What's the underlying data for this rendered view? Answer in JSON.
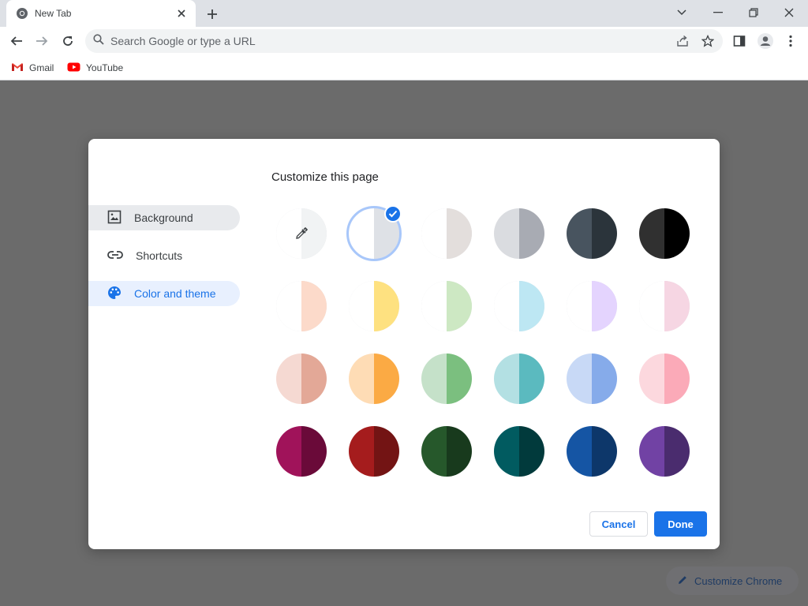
{
  "tab": {
    "title": "New Tab"
  },
  "omnibox": {
    "placeholder": "Search Google or type a URL"
  },
  "bookmarks": [
    {
      "label": "Gmail",
      "icon": "gmail-icon"
    },
    {
      "label": "YouTube",
      "icon": "youtube-icon"
    }
  ],
  "dialog": {
    "title": "Customize this page",
    "menu": [
      {
        "label": "Background",
        "icon": "image-icon",
        "state": "hover"
      },
      {
        "label": "Shortcuts",
        "icon": "link-icon",
        "state": "normal"
      },
      {
        "label": "Color and theme",
        "icon": "palette-icon",
        "state": "selected"
      }
    ],
    "swatches": [
      {
        "name": "custom-color-picker",
        "left": "#ffffff",
        "right": "#f1f3f4",
        "selected": false
      },
      {
        "name": "default",
        "left": "#ffffff",
        "right": "#dee1e6",
        "selected": true
      },
      {
        "name": "warm-grey",
        "left": "#ffffff",
        "right": "#e3dedc",
        "selected": false
      },
      {
        "name": "cool-grey",
        "left": "#dadce0",
        "right": "#a8abb3",
        "selected": false
      },
      {
        "name": "midnight-blue",
        "left": "#48545f",
        "right": "#2b343b",
        "selected": false
      },
      {
        "name": "black",
        "left": "#303030",
        "right": "#000000",
        "selected": false
      },
      {
        "name": "beige-and-white",
        "left": "#ffffff",
        "right": "#fcdaca",
        "selected": false
      },
      {
        "name": "yellow-and-white",
        "left": "#ffffff",
        "right": "#fee180",
        "selected": false
      },
      {
        "name": "green-and-white",
        "left": "#ffffff",
        "right": "#cde8c3",
        "selected": false
      },
      {
        "name": "light-teal-and-white",
        "left": "#ffffff",
        "right": "#bde7f3",
        "selected": false
      },
      {
        "name": "light-purple-and-white",
        "left": "#ffffff",
        "right": "#e4d4fe",
        "selected": false
      },
      {
        "name": "pink-and-white",
        "left": "#ffffff",
        "right": "#f6d6e3",
        "selected": false
      },
      {
        "name": "beige",
        "left": "#f5d9d2",
        "right": "#e3a897",
        "selected": false
      },
      {
        "name": "orange",
        "left": "#fedcb5",
        "right": "#fbaa44",
        "selected": false
      },
      {
        "name": "light-green",
        "left": "#c5e1c9",
        "right": "#7bbf7f",
        "selected": false
      },
      {
        "name": "light-teal",
        "left": "#b3e0e3",
        "right": "#5bbabf",
        "selected": false
      },
      {
        "name": "light-purple",
        "left": "#c8d9f6",
        "right": "#86abea",
        "selected": false
      },
      {
        "name": "pink",
        "left": "#fcd8de",
        "right": "#fbaab8",
        "selected": false
      },
      {
        "name": "dark-pink-and-red",
        "left": "#a0135a",
        "right": "#6a0a39",
        "selected": false
      },
      {
        "name": "dark-red-and-orange",
        "left": "#a51c1d",
        "right": "#731414",
        "selected": false
      },
      {
        "name": "dark-green",
        "left": "#26582b",
        "right": "#183a1d",
        "selected": false
      },
      {
        "name": "dark-teal",
        "left": "#015b60",
        "right": "#013a3c",
        "selected": false
      },
      {
        "name": "dark-blue",
        "left": "#1555a4",
        "right": "#0d376a",
        "selected": false
      },
      {
        "name": "purple",
        "left": "#7142a4",
        "right": "#4a2c6e",
        "selected": false
      }
    ],
    "cancel_label": "Cancel",
    "done_label": "Done"
  },
  "customize_chrome": {
    "label": "Customize Chrome"
  },
  "colors": {
    "accent": "#1a73e8",
    "overlay": "#6b6b6b"
  }
}
